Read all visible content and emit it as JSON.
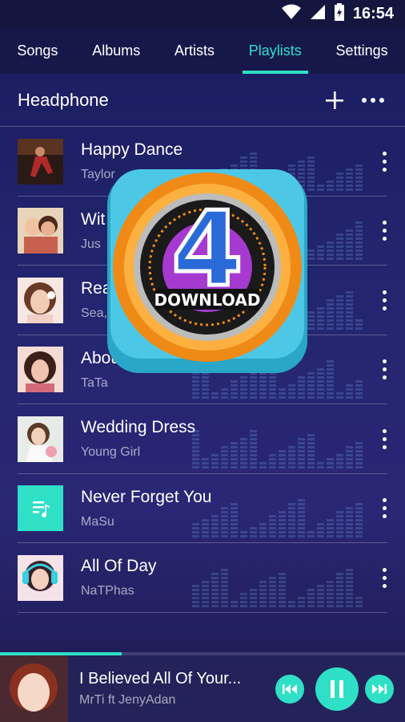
{
  "status_bar": {
    "time": "16:54"
  },
  "tabs": [
    {
      "label": "Songs",
      "active": false
    },
    {
      "label": "Albums",
      "active": false
    },
    {
      "label": "Artists",
      "active": false
    },
    {
      "label": "Playlists",
      "active": true
    },
    {
      "label": "Settings",
      "active": false
    }
  ],
  "playlist": {
    "title": "Headphone",
    "songs": [
      {
        "title": "Happy Dance",
        "artist": "Taylor"
      },
      {
        "title": "Wit",
        "artist": "Jus"
      },
      {
        "title": "Rea",
        "artist": "Sea,"
      },
      {
        "title": "Abou",
        "artist": "TaTa"
      },
      {
        "title": "Wedding Dress",
        "artist": "Young Girl"
      },
      {
        "title": "Never Forget You",
        "artist": "MaSu"
      },
      {
        "title": "All Of Day",
        "artist": "NaTPhas"
      }
    ]
  },
  "overlay_logo": {
    "text": "DOWNLOAD",
    "number": "4"
  },
  "player": {
    "title": "I Believed All Of Your...",
    "artist": "MrTi ft JenyAdan",
    "progress": 0.3
  },
  "colors": {
    "accent": "#2fe0c6",
    "background": "#1f2166"
  },
  "icons": [
    "wifi-icon",
    "signal-icon",
    "battery-icon",
    "add-icon",
    "more-icon",
    "music-note-icon",
    "previous-icon",
    "pause-icon",
    "next-icon"
  ]
}
